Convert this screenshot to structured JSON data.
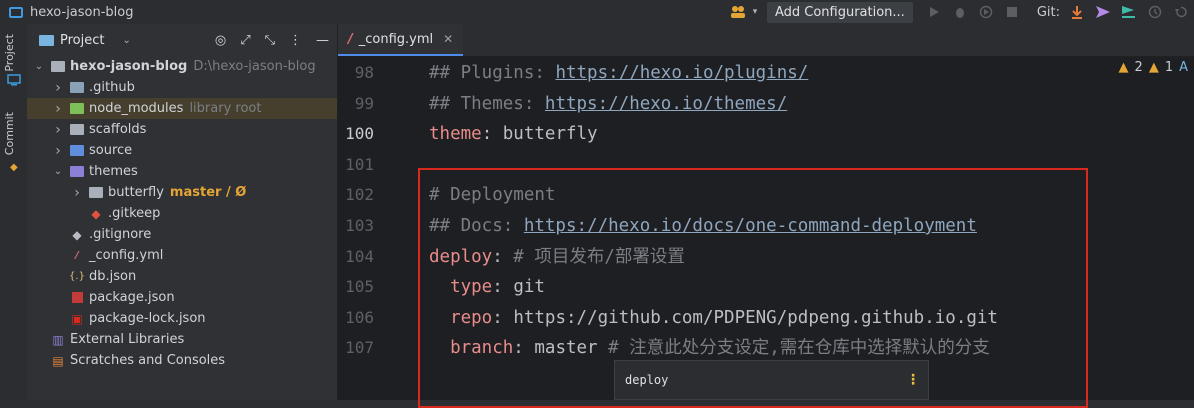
{
  "titlebar": {
    "project_name": "hexo-jason-blog",
    "add_configuration": "Add Configuration...",
    "git_label": "Git:"
  },
  "toolstrip": {
    "project_tab": "Project",
    "commit_tab": "Commit"
  },
  "project_panel": {
    "title": "Project",
    "tree": [
      {
        "name": "hexo-jason-blog",
        "hint": "D:\\hexo-jason-blog",
        "depth": 0,
        "expanded": true,
        "icon": "folder-icon"
      },
      {
        "name": ".github",
        "depth": 1,
        "expanded": false,
        "icon": "github-folder-icon"
      },
      {
        "name": "node_modules",
        "hint": "library root",
        "depth": 1,
        "expanded": false,
        "icon": "node-folder-icon",
        "selected": true
      },
      {
        "name": "scaffolds",
        "depth": 1,
        "expanded": false,
        "icon": "folder-icon"
      },
      {
        "name": "source",
        "depth": 1,
        "expanded": false,
        "icon": "source-folder-icon"
      },
      {
        "name": "themes",
        "depth": 1,
        "expanded": true,
        "icon": "themes-folder-icon"
      },
      {
        "name": "butterfly",
        "branch": "master / Ø",
        "depth": 2,
        "expanded": false,
        "icon": "folder-icon"
      },
      {
        "name": ".gitkeep",
        "depth": 2,
        "icon": "git-file-icon"
      },
      {
        "name": ".gitignore",
        "depth": 1,
        "icon": "gitignore-file-icon"
      },
      {
        "name": "_config.yml",
        "depth": 1,
        "icon": "yaml-file-icon"
      },
      {
        "name": "db.json",
        "depth": 1,
        "icon": "json-file-icon"
      },
      {
        "name": "package.json",
        "depth": 1,
        "icon": "npm-file-icon"
      },
      {
        "name": "package-lock.json",
        "depth": 1,
        "icon": "lock-file-icon"
      },
      {
        "name": "External Libraries",
        "depth": 0,
        "icon": "library-icon"
      },
      {
        "name": "Scratches and Consoles",
        "depth": 0,
        "icon": "scratches-icon"
      }
    ]
  },
  "editor": {
    "tab_label": "_config.yml",
    "warnings": {
      "warning_count_a": "2",
      "warning_count_b": "1"
    },
    "lines": [
      {
        "num": "98",
        "comment": "## Plugins: ",
        "link": "https://hexo.io/plugins/"
      },
      {
        "num": "99",
        "comment": "## Themes: ",
        "link": "https://hexo.io/themes/"
      },
      {
        "num": "100",
        "key": "theme",
        "value": " butterfly",
        "current": true
      },
      {
        "num": "101"
      },
      {
        "num": "102",
        "comment": "# Deployment"
      },
      {
        "num": "103",
        "comment": "## Docs: ",
        "link": "https://hexo.io/docs/one-command-deployment"
      },
      {
        "num": "104",
        "key": "deploy",
        "trail_comment": " # 项目发布/部署设置"
      },
      {
        "num": "105",
        "indent": "  ",
        "key": "type",
        "value": " git"
      },
      {
        "num": "106",
        "indent": "  ",
        "key": "repo",
        "value": " https://github.com/PDPENG/pdpeng.github.io.git"
      },
      {
        "num": "107",
        "indent": "  ",
        "key": "branch",
        "value": " master",
        "trail_comment": " # 注意此处分支设定,需在仓库中选择默认的分支"
      }
    ],
    "popup_text": "deploy"
  },
  "colors": {
    "accent": "#4d8ce8",
    "highlight_border": "#d9281e",
    "yaml_key": "#e88c8c",
    "branch_label": "#e5a536"
  }
}
